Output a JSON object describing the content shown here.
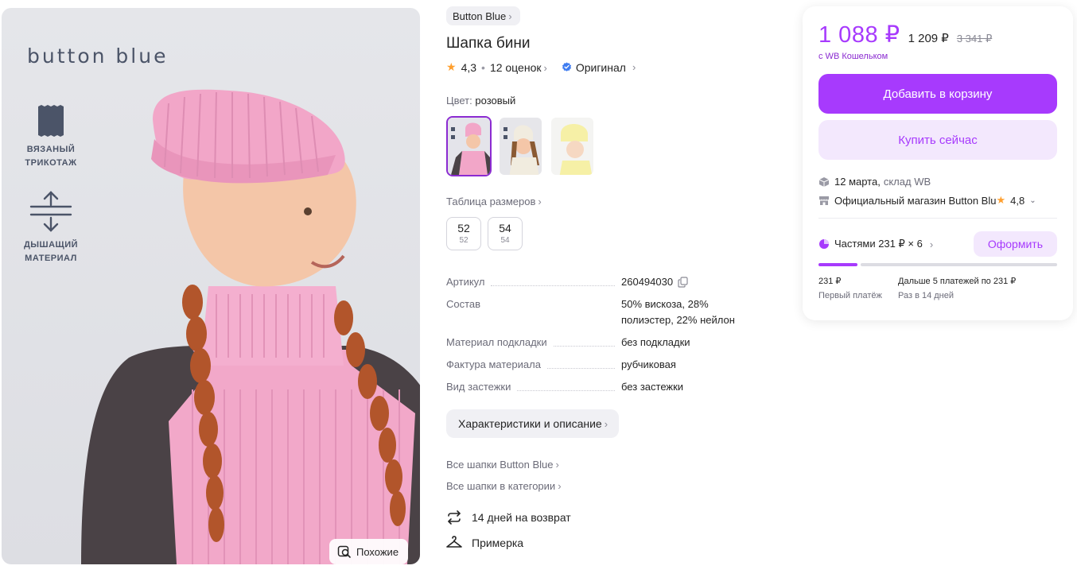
{
  "gallery": {
    "brand_watermark": "button blue",
    "features": [
      {
        "icon": "knit-fabric-icon",
        "label_line1": "ВЯЗАНЫЙ",
        "label_line2": "ТРИКОТАЖ"
      },
      {
        "icon": "breathable-arrows-icon",
        "label_line1": "ДЫШАЩИЙ",
        "label_line2": "МАТЕРИАЛ"
      }
    ],
    "similar_label": "Похожие"
  },
  "product": {
    "brand": "Button Blue",
    "title": "Шапка бини",
    "rating": "4,3",
    "reviews": "12 оценок",
    "original_label": "Оригинал",
    "color_label": "Цвет:",
    "color_value": "розовый",
    "colors": [
      "pink",
      "cream",
      "yellow"
    ],
    "size_table_label": "Таблица размеров",
    "sizes": [
      {
        "main": "52",
        "sub": "52"
      },
      {
        "main": "54",
        "sub": "54"
      }
    ],
    "specs": [
      {
        "key": "Артикул",
        "value": "260494030"
      },
      {
        "key": "Состав",
        "value": "50% вискоза, 28% полиэстер, 22% нейлон"
      },
      {
        "key": "Материал подкладки",
        "value": "без подкладки"
      },
      {
        "key": "Фактура материала",
        "value": "рубчиковая"
      },
      {
        "key": "Вид застежки",
        "value": "без застежки"
      }
    ],
    "desc_button": "Характеристики и описание",
    "links": [
      "Все шапки Button Blue",
      "Все шапки в категории"
    ],
    "perks": [
      {
        "icon": "return-arrows-icon",
        "label": "14 дней на возврат"
      },
      {
        "icon": "hanger-icon",
        "label": "Примерка"
      }
    ]
  },
  "buy": {
    "price": "1 088 ₽",
    "price_no_wallet": "1 209 ₽",
    "price_old": "3 341 ₽",
    "wallet_note": "с WB Кошельком",
    "add_to_cart": "Добавить в корзину",
    "buy_now": "Купить сейчас",
    "delivery_date": "12 марта,",
    "delivery_warehouse": "склад WB",
    "shop_name": "Официальный магазин Button Blu",
    "shop_rating": "4,8",
    "installments_label": "Частями 231 ₽ × 6",
    "installments_button": "Оформить",
    "installments_progress": 0.1667,
    "first_payment_amount": "231 ₽",
    "first_payment_label": "Первый платёж",
    "next_payments_amount": "Дальше 5 платежей по 231 ₽",
    "next_payments_label": "Раз в 14 дней"
  },
  "colors": {
    "accent": "#a73afd",
    "accent_light": "#f3e8fd",
    "star": "#ff9f2e",
    "verified": "#3f7cf0"
  }
}
